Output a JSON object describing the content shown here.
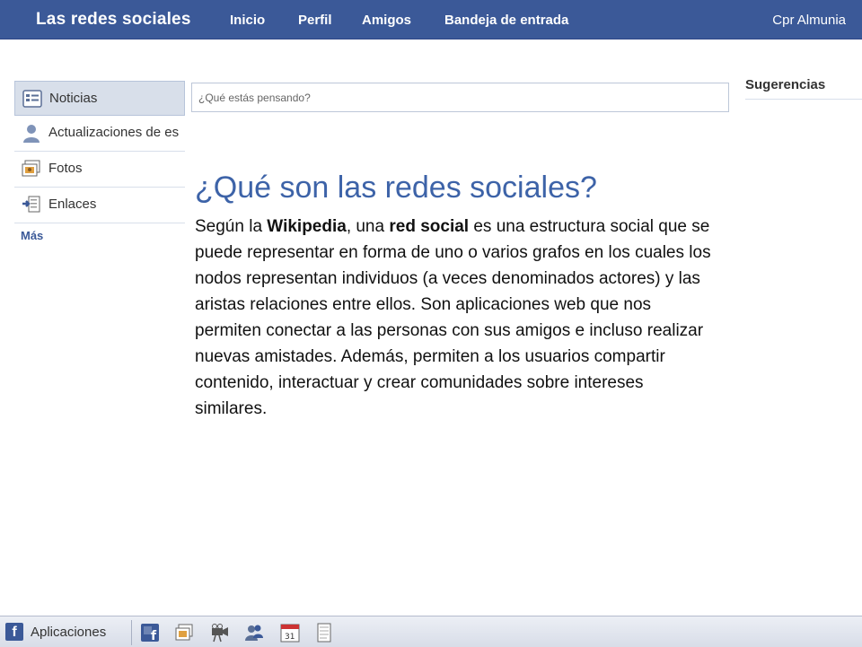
{
  "header": {
    "brand": "Las redes sociales",
    "nav": [
      "Inicio",
      "Perfil",
      "Amigos",
      "Bandeja de entrada"
    ],
    "user": "Cpr Almunia"
  },
  "sidebar": {
    "items": [
      {
        "label": "Noticias",
        "icon": "news-feed-icon"
      },
      {
        "label": "Actualizaciones de es",
        "icon": "person-icon"
      },
      {
        "label": "Fotos",
        "icon": "photos-icon"
      },
      {
        "label": "Enlaces",
        "icon": "links-icon"
      }
    ],
    "more": "Más"
  },
  "status": {
    "placeholder": "¿Qué estás pensando?"
  },
  "right": {
    "title": "Sugerencias"
  },
  "article": {
    "title": "¿Qué son las redes sociales?",
    "p_1": "Según la ",
    "p_bold_1": "Wikipedia",
    "p_2": ", una ",
    "p_bold_2": "red social",
    "p_3": " es una estructura social que se puede representar en forma de uno o varios grafos en los cuales los nodos representan individuos (a veces denominados actores) y las aristas relaciones entre ellos. Son aplicaciones web que nos permiten conectar a las personas con sus amigos e incluso realizar nuevas amistades. Además, permiten a los usuarios compartir contenido, interactuar y crear comunidades sobre intereses similares."
  },
  "bottom": {
    "apps_label": "Aplicaciones",
    "calendar_day": "31",
    "icons": [
      "facebook-icon",
      "groups-icon",
      "photos-icon",
      "video-icon",
      "friends-icon",
      "calendar-icon",
      "notes-icon"
    ]
  },
  "colors": {
    "brand_blue": "#3b5998",
    "title_blue": "#3d63a8",
    "active_item": "#d8dfea"
  }
}
